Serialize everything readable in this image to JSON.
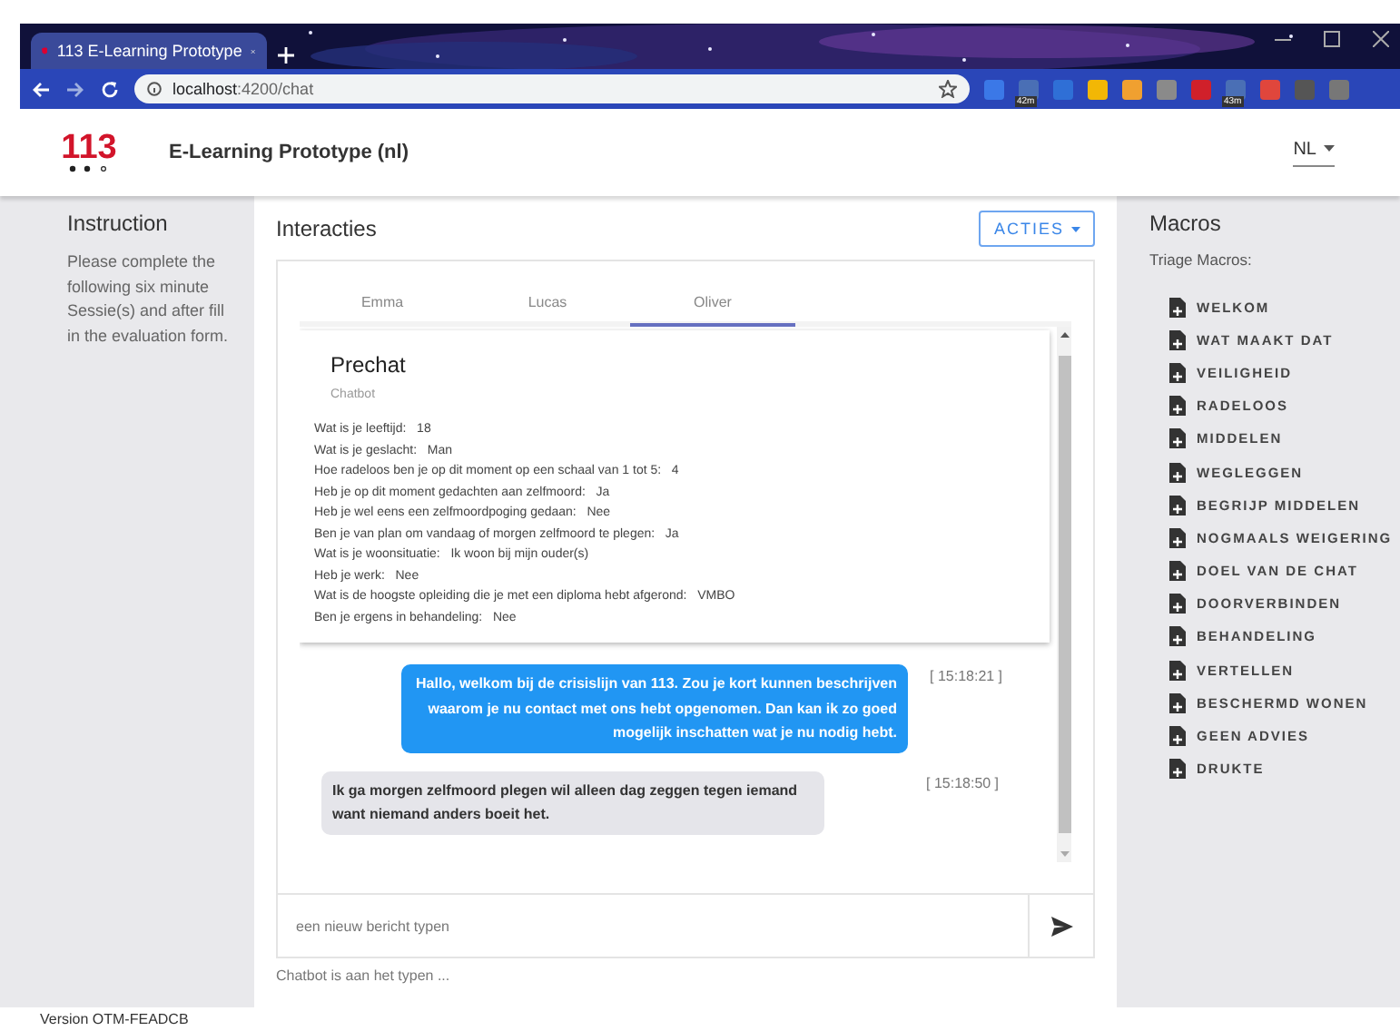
{
  "browser": {
    "tab_title": "113 E-Learning Prototype",
    "url_host": "localhost",
    "url_path": ":4200/chat",
    "extensions": [
      {
        "color": "#3b78e7"
      },
      {
        "color": "#4a6fb5",
        "badge": "42m"
      },
      {
        "color": "#2f6fd6"
      },
      {
        "color": "#f2b705"
      },
      {
        "color": "#f0a030"
      },
      {
        "color": "#8a8a8a"
      },
      {
        "color": "#d0202a"
      },
      {
        "color": "#4a6fb5",
        "badge": "43m"
      },
      {
        "color": "#e0463c"
      },
      {
        "color": "#555555"
      },
      {
        "color": "#777777"
      }
    ]
  },
  "header": {
    "logo": "113",
    "title": "E-Learning Prototype (nl)",
    "language": "NL"
  },
  "instruction": {
    "title": "Instruction",
    "text": "Please complete the following six minute Sessie(s) and after fill in the evaluation form."
  },
  "interactions": {
    "title": "Interacties",
    "actions_button": "ACTIES",
    "tabs": [
      {
        "label": "Emma",
        "selected": false
      },
      {
        "label": "Lucas",
        "selected": false
      },
      {
        "label": "Oliver",
        "selected": true
      }
    ],
    "prechat": {
      "title": "Prechat",
      "subtitle": "Chatbot",
      "lines": [
        {
          "question": "Wat is je leeftijd:",
          "answer": "18"
        },
        {
          "question": "Wat is je geslacht:",
          "answer": "Man"
        },
        {
          "question": "Hoe radeloos ben je op dit moment op een schaal van 1 tot 5:",
          "answer": "4"
        },
        {
          "question": "Heb je op dit moment gedachten aan zelfmoord:",
          "answer": "Ja"
        },
        {
          "question": "Heb je wel eens een zelfmoordpoging gedaan:",
          "answer": "Nee"
        },
        {
          "question": "Ben je van plan om vandaag of morgen zelfmoord te plegen:",
          "answer": "Ja"
        },
        {
          "question": "Wat is je woonsituatie:",
          "answer": "Ik woon bij mijn ouder(s)"
        },
        {
          "question": "Heb je werk:",
          "answer": "Nee"
        },
        {
          "question": "Wat is de hoogste opleiding die je met een diploma hebt afgerond:",
          "answer": "VMBO"
        },
        {
          "question": "Ben je ergens in behandeling:",
          "answer": "Nee"
        }
      ]
    },
    "messages": [
      {
        "kind": "agent",
        "text": "Hallo, welkom bij de crisislijn van 113. Zou je kort kunnen beschrijven waarom je nu contact met ons hebt opgenomen. Dan kan ik zo goed mogelijk inschatten wat je nu nodig hebt.",
        "time": "[ 15:18:21 ]"
      },
      {
        "kind": "client",
        "text": "Ik ga morgen zelfmoord plegen wil alleen dag zeggen tegen iemand want niemand anders boeit het.",
        "time": "[ 15:18:50 ]"
      }
    ],
    "input": {
      "placeholder": "een nieuw bericht typen"
    },
    "typing_status": "Chatbot is aan het typen ..."
  },
  "macros": {
    "title": "Macros",
    "subtitle": "Triage Macros:",
    "items": [
      "WELKOM",
      "WAT MAAKT DAT",
      "VEILIGHEID",
      "RADELOOS",
      "MIDDELEN",
      "WEGLEGGEN",
      "BEGRIJP MIDDELEN",
      "NOGMAALS WEIGERING",
      "DOEL VAN DE CHAT",
      "DOORVERBINDEN",
      "BEHANDELING",
      "VERTELLEN",
      "BESCHERMD WONEN",
      "GEEN ADVIES",
      "DRUKTE"
    ]
  },
  "footer": {
    "version": "Version OTM-FEADCB"
  }
}
